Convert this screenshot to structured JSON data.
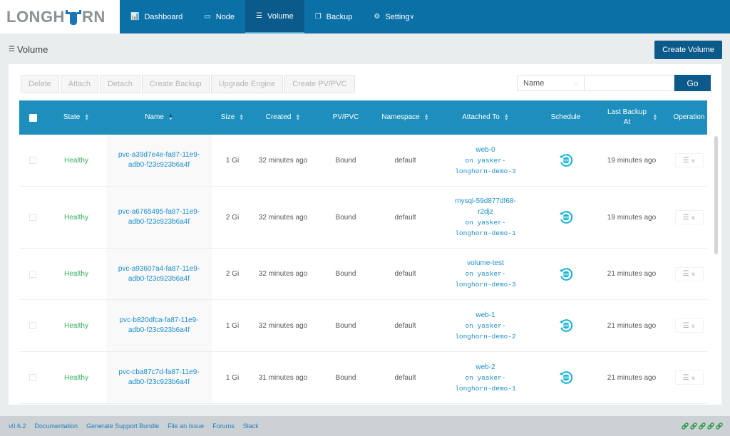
{
  "brand": {
    "name_left": "LONGH",
    "name_right": "RN"
  },
  "nav": [
    {
      "label": "Dashboard",
      "icon": "chart-icon",
      "glyph": "📊",
      "active": false
    },
    {
      "label": "Node",
      "icon": "laptop-icon",
      "glyph": "▭",
      "active": false
    },
    {
      "label": "Volume",
      "icon": "database-icon",
      "glyph": "☰",
      "active": true
    },
    {
      "label": "Backup",
      "icon": "copy-icon",
      "glyph": "❐",
      "active": false
    },
    {
      "label": "Setting",
      "icon": "gear-icon",
      "glyph": "⚙",
      "active": false,
      "dropdown": true
    }
  ],
  "page": {
    "title": "Volume",
    "title_icon": "☰",
    "create_button": "Create Volume"
  },
  "toolbar": {
    "buttons": [
      "Delete",
      "Attach",
      "Detach",
      "Create Backup",
      "Upgrade Engine",
      "Create PV/PVC"
    ],
    "search_field": "Name",
    "search_value": "",
    "go_label": "Go"
  },
  "table": {
    "columns": [
      "State",
      "Name",
      "Size",
      "Created",
      "PV/PVC",
      "Namespace",
      "Attached To",
      "Schedule",
      "Last Backup At",
      "Operation"
    ],
    "rows": [
      {
        "state": "Healthy",
        "name1": "pvc-a39d7e4e-fa87-11e9-",
        "name2": "adb0-f23c923b6a4f",
        "size": "1 Gi",
        "created": "32 minutes ago",
        "pv": "Bound",
        "namespace": "default",
        "attached": "web-0",
        "host1": "on yasker-",
        "host2": "longhorn-demo-3",
        "last_backup": "19 minutes ago"
      },
      {
        "state": "Healthy",
        "name1": "pvc-a6765495-fa87-11e9-",
        "name2": "adb0-f23c923b6a4f",
        "size": "2 Gi",
        "created": "32 minutes ago",
        "pv": "Bound",
        "namespace": "default",
        "attached": "mysql-59d877df68-r2djz",
        "host1": "on yasker-",
        "host2": "longhorn-demo-1",
        "last_backup": "19 minutes ago"
      },
      {
        "state": "Healthy",
        "name1": "pvc-a93607a4-fa87-11e9-",
        "name2": "adb0-f23c923b6a4f",
        "size": "2 Gi",
        "created": "32 minutes ago",
        "pv": "Bound",
        "namespace": "default",
        "attached": "volume-test",
        "host1": "on yasker-",
        "host2": "longhorn-demo-3",
        "last_backup": "21 minutes ago"
      },
      {
        "state": "Healthy",
        "name1": "pvc-b820dfca-fa87-11e9-",
        "name2": "adb0-f23c923b6a4f",
        "size": "1 Gi",
        "created": "32 minutes ago",
        "pv": "Bound",
        "namespace": "default",
        "attached": "web-1",
        "host1": "on yasker-",
        "host2": "longhorn-demo-2",
        "last_backup": "21 minutes ago"
      },
      {
        "state": "Healthy",
        "name1": "pvc-cba87c7d-fa87-11e9-",
        "name2": "adb0-f23c923b6a4f",
        "size": "1 Gi",
        "created": "31 minutes ago",
        "pv": "Bound",
        "namespace": "default",
        "attached": "web-2",
        "host1": "on yasker-",
        "host2": "longhorn-demo-1",
        "last_backup": "21 minutes ago"
      }
    ]
  },
  "footer": {
    "links": [
      "v0.6.2",
      "Documentation",
      "Generate Support Bundle",
      "File an Issue",
      "Forums",
      "Slack"
    ],
    "status_icons": 5
  },
  "colors": {
    "header": "#0b70a6",
    "table_header": "#1e8fbd",
    "healthy": "#36b05d",
    "link": "#1e8fd0",
    "primary_button": "#0c5a8a"
  }
}
